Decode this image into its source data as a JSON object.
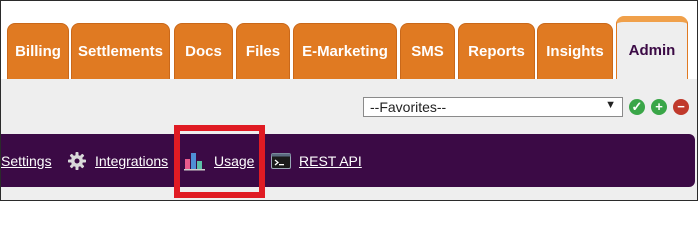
{
  "tabs": [
    {
      "label": "Billing",
      "active": false
    },
    {
      "label": "Settlements",
      "active": false
    },
    {
      "label": "Docs",
      "active": false
    },
    {
      "label": "Files",
      "active": false
    },
    {
      "label": "E-Marketing",
      "active": false
    },
    {
      "label": "SMS",
      "active": false
    },
    {
      "label": "Reports",
      "active": false
    },
    {
      "label": "Insights",
      "active": false
    },
    {
      "label": "Admin",
      "active": true
    }
  ],
  "favorites": {
    "selected": "--Favorites--"
  },
  "favorite_actions": [
    "check-icon",
    "plus-icon",
    "minus-icon"
  ],
  "nav": {
    "settings": {
      "label": "Settings",
      "icon": "none"
    },
    "integrations": {
      "label": "Integrations",
      "icon": "gear-icon"
    },
    "usage": {
      "label": "Usage",
      "icon": "bar-chart-icon"
    },
    "rest_api": {
      "label": "REST API",
      "icon": "terminal-icon"
    }
  },
  "colors": {
    "tab": "#e07a22",
    "nav_bg": "#3b0a45",
    "highlight": "#e01b23"
  }
}
